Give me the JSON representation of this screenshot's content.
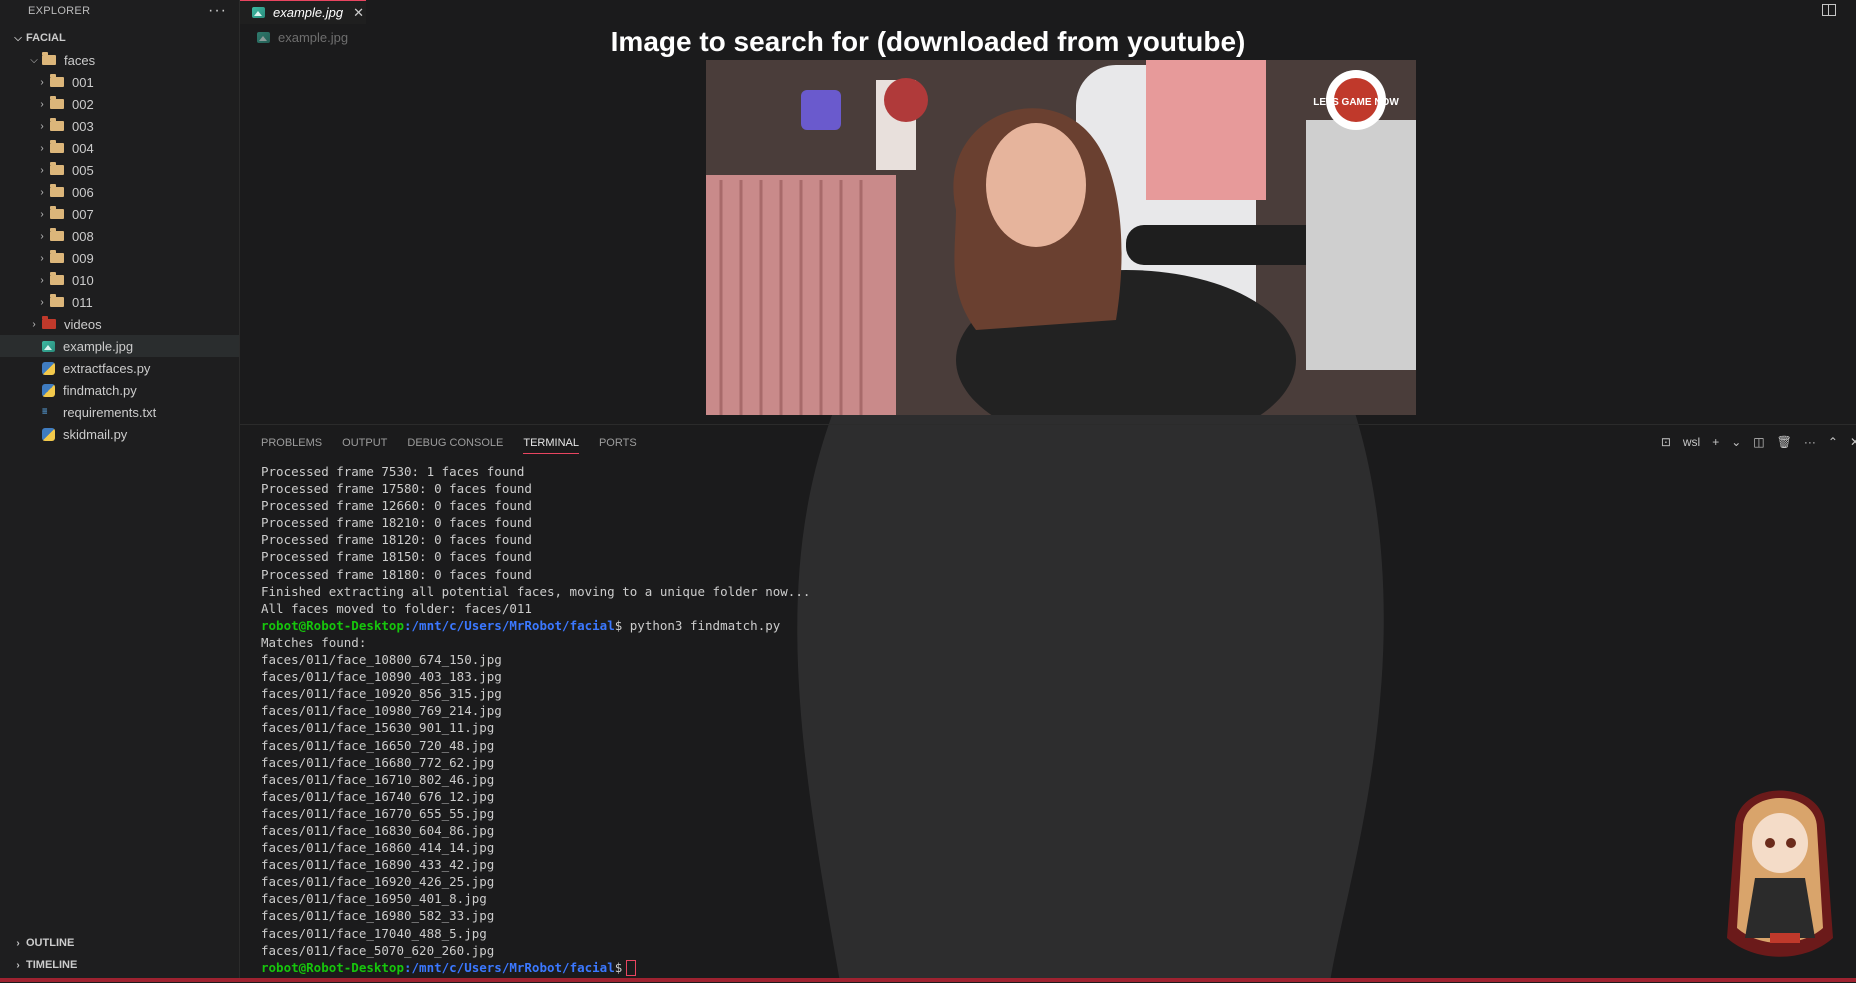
{
  "sidebar": {
    "title": "EXPLORER",
    "folder_root": "FACIAL",
    "faces_folder": "faces",
    "face_subfolders": [
      "001",
      "002",
      "003",
      "004",
      "005",
      "006",
      "007",
      "008",
      "009",
      "010",
      "011"
    ],
    "videos_folder": "videos",
    "files": [
      {
        "name": "example.jpg",
        "icon": "image-icon"
      },
      {
        "name": "extractfaces.py",
        "icon": "python-icon"
      },
      {
        "name": "findmatch.py",
        "icon": "python-icon"
      },
      {
        "name": "requirements.txt",
        "icon": "text-file-icon"
      },
      {
        "name": "skidmail.py",
        "icon": "python-icon"
      }
    ],
    "outline": "OUTLINE",
    "timeline": "TIMELINE"
  },
  "editor": {
    "tab_label": "example.jpg",
    "breadcrumb": "example.jpg",
    "image_title": "Image to search for (downloaded from youtube)",
    "logo_text": "LETS GAME NOW"
  },
  "panel": {
    "tabs": [
      "PROBLEMS",
      "OUTPUT",
      "DEBUG CONSOLE",
      "TERMINAL",
      "PORTS"
    ],
    "active_tab": "TERMINAL",
    "shell_label": "wsl"
  },
  "terminal": {
    "lines_before": [
      "Processed frame 7530: 1 faces found",
      "Processed frame 17580: 0 faces found",
      "Processed frame 12660: 0 faces found",
      "Processed frame 18210: 0 faces found",
      "Processed frame 18120: 0 faces found",
      "Processed frame 18150: 0 faces found",
      "Processed frame 18180: 0 faces found",
      "Finished extracting all potential faces, moving to a unique folder now...",
      "All faces moved to folder: faces/011"
    ],
    "prompt_user": "robot@Robot-Desktop",
    "prompt_path": ":/mnt/c/Users/MrRobot/facial",
    "command": "$ python3 findmatch.py",
    "lines_after": [
      "Matches found:",
      "faces/011/face_10800_674_150.jpg",
      "faces/011/face_10890_403_183.jpg",
      "faces/011/face_10920_856_315.jpg",
      "faces/011/face_10980_769_214.jpg",
      "faces/011/face_15630_901_11.jpg",
      "faces/011/face_16650_720_48.jpg",
      "faces/011/face_16680_772_62.jpg",
      "faces/011/face_16710_802_46.jpg",
      "faces/011/face_16740_676_12.jpg",
      "faces/011/face_16770_655_55.jpg",
      "faces/011/face_16830_604_86.jpg",
      "faces/011/face_16860_414_14.jpg",
      "faces/011/face_16890_433_42.jpg",
      "faces/011/face_16920_426_25.jpg",
      "faces/011/face_16950_401_8.jpg",
      "faces/011/face_16980_582_33.jpg",
      "faces/011/face_17040_488_5.jpg",
      "faces/011/face_5070_620_260.jpg"
    ],
    "final_prompt_suffix": "$"
  },
  "colors": {
    "accent": "#e94560",
    "prompt_user": "#16c60c",
    "prompt_path": "#3b78ff",
    "status_bar": "#9e2230"
  }
}
